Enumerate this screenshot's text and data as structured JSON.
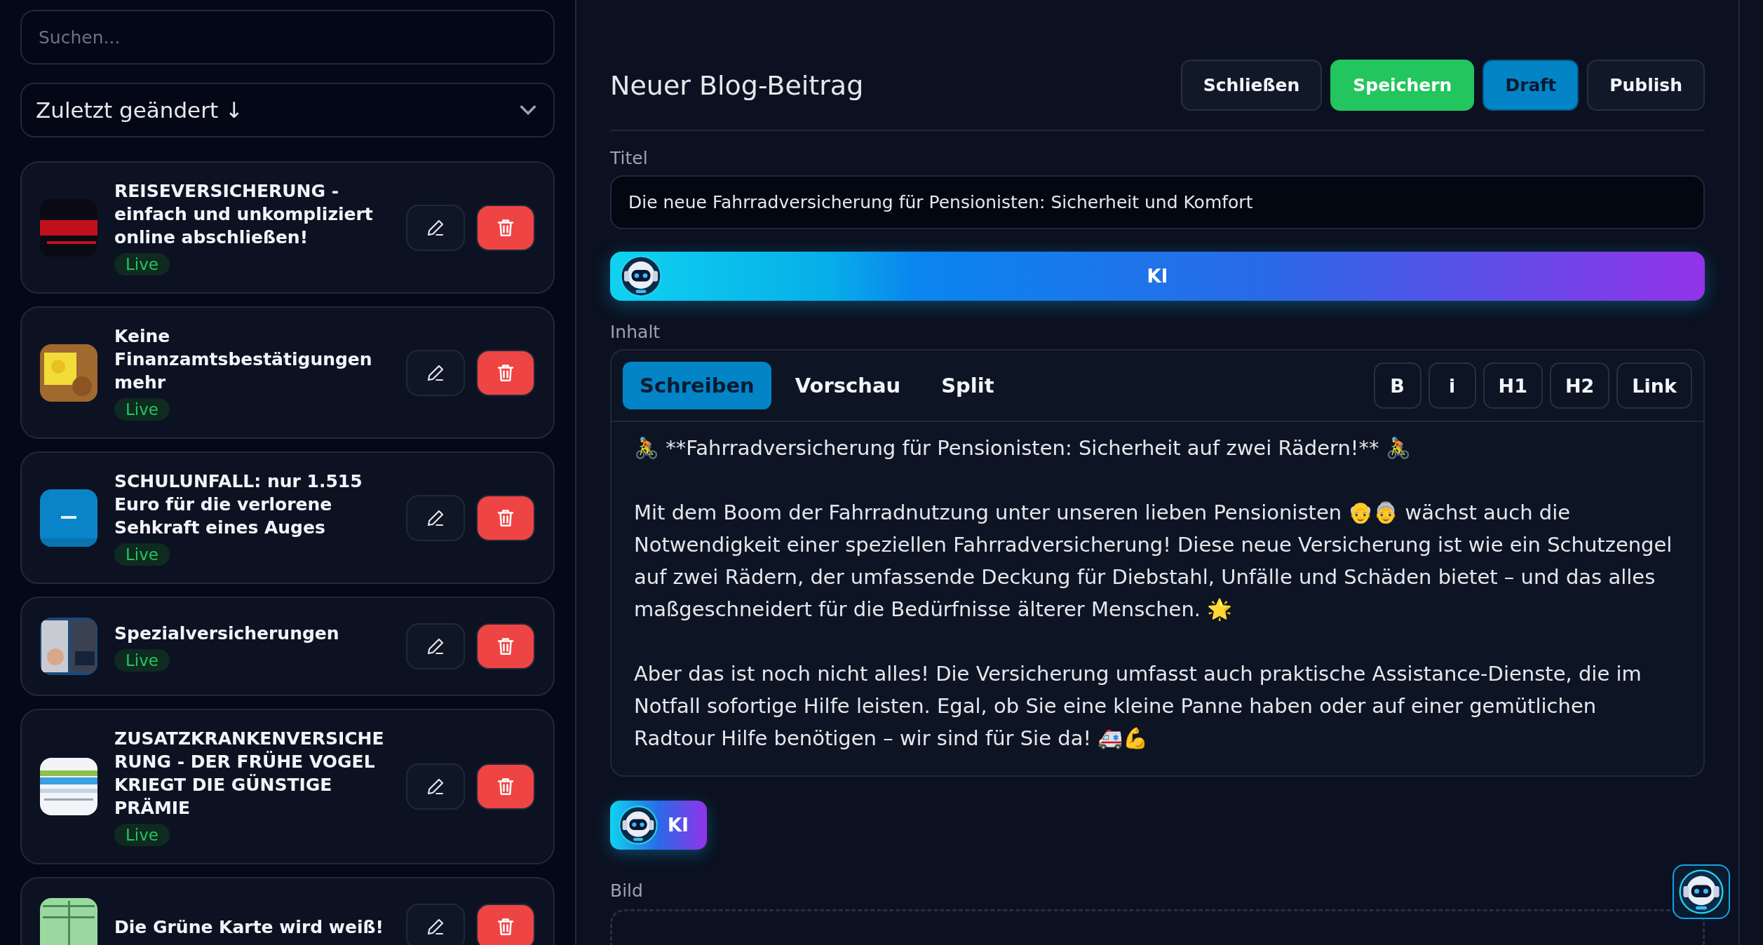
{
  "sidebar": {
    "search": {
      "placeholder": "Suchen..."
    },
    "sort": {
      "value": "Zuletzt geändert ↓"
    },
    "posts": [
      {
        "title": "REISEVERSICHERUNG - einfach und unkompliziert online abschließen!",
        "status": "Live"
      },
      {
        "title": "Keine Finanzamtsbestätigungen mehr",
        "status": "Live"
      },
      {
        "title": "SCHULUNFALL: nur 1.515 Euro für die verlorene Sehkraft eines Auges",
        "status": "Live"
      },
      {
        "title": "Spezialversicherungen",
        "status": "Live"
      },
      {
        "title": "ZUSATZKRANKENVERSICHE RUNG - DER FRÜHE VOGEL KRIEGT DIE GÜNSTIGE PRÄMIE",
        "status": "Live"
      },
      {
        "title": "Die Grüne Karte wird weiß!"
      }
    ]
  },
  "editor": {
    "heading": "Neuer Blog-Beitrag",
    "actions": [
      {
        "label": "Schließen",
        "kind": "secondary"
      },
      {
        "label": "Speichern",
        "kind": "primary"
      }
    ],
    "status_toggle": [
      {
        "label": "Draft",
        "selected": true
      },
      {
        "label": "Publish",
        "selected": false
      }
    ],
    "title_label": "Titel",
    "title_value": "Die neue Fahrradversicherung für Pensionisten: Sicherheit und Komfort",
    "ai_bar": "KI",
    "content_label": "Inhalt",
    "tabs": [
      {
        "label": "Schreiben",
        "selected": true
      },
      {
        "label": "Vorschau",
        "selected": false
      },
      {
        "label": "Split",
        "selected": false
      }
    ],
    "format_buttons": [
      "B",
      "i",
      "H1",
      "H2",
      "Link"
    ],
    "content": "🚴 **Fahrradversicherung für Pensionisten: Sicherheit auf zwei Rädern!** 🚴\n\nMit dem Boom der Fahrradnutzung unter unseren lieben Pensionisten 👴👵 wächst auch die Notwendigkeit einer speziellen Fahrradversicherung! Diese neue Versicherung ist wie ein Schutzengel auf zwei Rädern, der umfassende Deckung für Diebstahl, Unfälle und Schäden bietet – und das alles maßgeschneidert für die Bedürfnisse älterer Menschen. 🌟\n\nAber das ist noch nicht alles! Die Versicherung umfasst auch praktische Assistance-Dienste, die im Notfall sofortige Hilfe leisten. Egal, ob Sie eine kleine Panne haben oder auf einer gemütlichen Radtour Hilfe benötigen – wir sind für Sie da! 🚑💪",
    "ai_button": "KI",
    "image_label": "Bild"
  }
}
